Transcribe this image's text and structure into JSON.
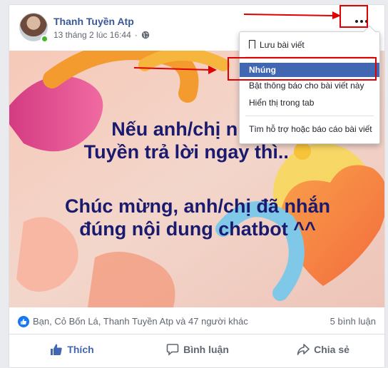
{
  "post": {
    "author": "Thanh Tuyền Atp",
    "timestamp": "13 tháng 2 lúc 16:44",
    "privacy_icon": "globe-icon",
    "text_lines": [
      "Nếu anh/chị nhắn t",
      "Tuyền trả lời ngay thì..",
      "Chúc mừng, anh/chị đã nhắn",
      "đúng nội dung chatbot ^^"
    ]
  },
  "menu": {
    "items": [
      {
        "label": "Lưu bài viết",
        "icon": "bookmark-icon"
      },
      {
        "label": "Nhúng",
        "active": true
      },
      {
        "label": "Bật thông báo cho bài viết này"
      },
      {
        "label": "Hiển thị trong tab"
      },
      {
        "label": "Tìm hỗ trợ hoặc báo cáo bài viết"
      }
    ]
  },
  "stats": {
    "reactors": "Bạn, Cỏ Bốn Lá, Thanh Tuyền Atp và 47 người khác",
    "comments": "5 bình luận"
  },
  "actions": {
    "like": "Thích",
    "comment": "Bình luận",
    "share": "Chia sẻ"
  },
  "colors": {
    "brand_blue": "#4267b2",
    "highlight_red": "#e00000",
    "post_text": "#1a1a6e"
  }
}
